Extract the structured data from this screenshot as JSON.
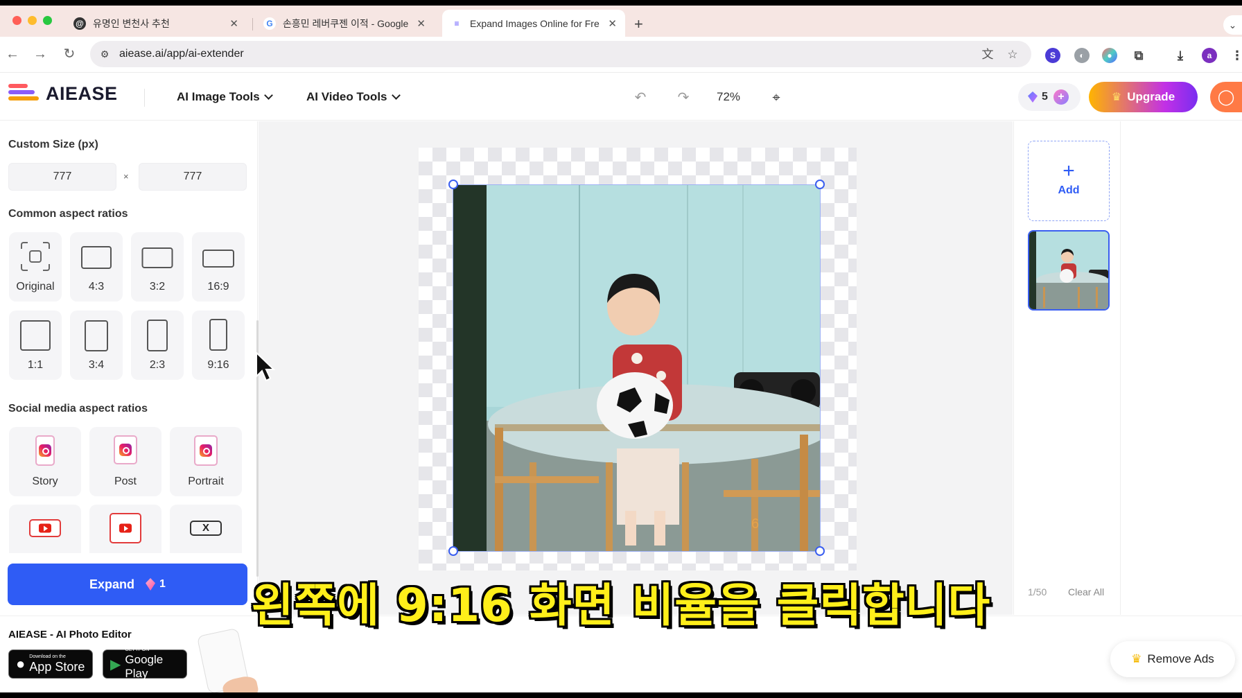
{
  "browser": {
    "tabs": [
      {
        "title": "유명인 변천사 추천",
        "active": false
      },
      {
        "title": "손흥민 레버쿠젠 이적 - Google S",
        "active": false
      },
      {
        "title": "Expand Images Online for Fre",
        "active": true
      }
    ],
    "url": "aiease.ai/app/ai-extender",
    "profile_initial": "a"
  },
  "header": {
    "logo": "AIEASE",
    "menu": [
      "AI Image Tools",
      "AI Video Tools"
    ],
    "zoom": "72%",
    "credits": "5",
    "upgrade_label": "Upgrade"
  },
  "left_panel": {
    "custom_size_title": "Custom Size (px)",
    "width": "777",
    "height": "777",
    "times": "×",
    "common_title": "Common aspect ratios",
    "common_ratios": [
      "Original",
      "4:3",
      "3:2",
      "16:9",
      "1:1",
      "3:4",
      "2:3",
      "9:16"
    ],
    "social_title": "Social media aspect ratios",
    "social_ratios": [
      "Story",
      "Post",
      "Portrait"
    ],
    "x_icon_text": "X",
    "expand_label": "Expand",
    "expand_cost": "1"
  },
  "right_panel": {
    "add_label": "Add",
    "count": "1/50",
    "clear_label": "Clear All"
  },
  "promo": {
    "title": "AIEASE - AI Photo Editor",
    "app_store_small": "Download on the",
    "app_store_big": "App Store",
    "google_play_small": "GET IT ON",
    "google_play_big": "Google Play",
    "remove_ads": "Remove Ads"
  },
  "subtitle": "왼쪽에 9:16 화면 비율을 클릭합니다",
  "colors": {
    "accent": "#2f5cf5",
    "subtitle": "#ffef1a",
    "tabstrip": "#f6e6e3"
  }
}
